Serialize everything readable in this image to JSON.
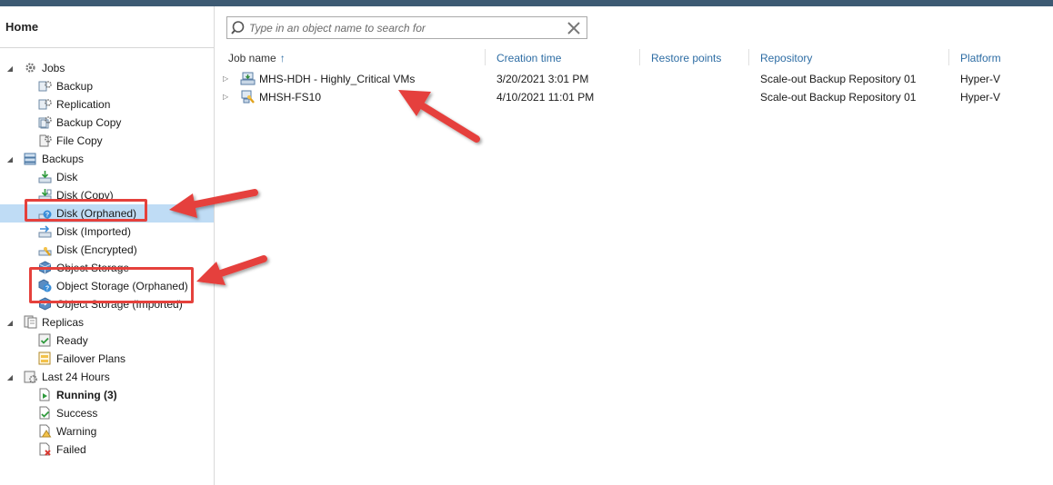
{
  "sidebar": {
    "title": "Home",
    "tree": [
      {
        "label": "Jobs",
        "icon": "jobs-gear-icon",
        "bold": false
      },
      {
        "label": "Backup",
        "icon": "backup-job-icon",
        "bold": false
      },
      {
        "label": "Replication",
        "icon": "replication-job-icon",
        "bold": false
      },
      {
        "label": "Backup Copy",
        "icon": "backup-copy-job-icon",
        "bold": false
      },
      {
        "label": "File Copy",
        "icon": "file-copy-job-icon",
        "bold": false
      },
      {
        "label": "Backups",
        "icon": "backups-icon",
        "bold": false
      },
      {
        "label": "Disk",
        "icon": "disk-icon",
        "bold": false
      },
      {
        "label": "Disk (Copy)",
        "icon": "disk-copy-icon",
        "bold": false
      },
      {
        "label": "Disk (Orphaned)",
        "icon": "disk-orphaned-icon",
        "bold": false
      },
      {
        "label": "Disk (Imported)",
        "icon": "disk-imported-icon",
        "bold": false
      },
      {
        "label": "Disk (Encrypted)",
        "icon": "disk-encrypted-icon",
        "bold": false
      },
      {
        "label": "Object Storage",
        "icon": "object-storage-icon",
        "bold": false
      },
      {
        "label": "Object Storage (Orphaned)",
        "icon": "object-storage-orphaned-icon",
        "bold": false
      },
      {
        "label": "Object Storage (Imported)",
        "icon": "object-storage-imported-icon",
        "bold": false
      },
      {
        "label": "Replicas",
        "icon": "replicas-icon",
        "bold": false
      },
      {
        "label": "Ready",
        "icon": "ready-icon",
        "bold": false
      },
      {
        "label": "Failover Plans",
        "icon": "failover-plans-icon",
        "bold": false
      },
      {
        "label": "Last 24 Hours",
        "icon": "last-24-hours-icon",
        "bold": false
      },
      {
        "label": "Running (3)",
        "icon": "running-icon",
        "bold": true
      },
      {
        "label": "Success",
        "icon": "success-icon",
        "bold": false
      },
      {
        "label": "Warning",
        "icon": "warning-icon",
        "bold": false
      },
      {
        "label": "Failed",
        "icon": "failed-icon",
        "bold": false
      }
    ]
  },
  "search": {
    "placeholder": "Type in an object name to search for",
    "value": ""
  },
  "grid": {
    "columns": [
      "Job name",
      "Creation time",
      "Restore points",
      "Repository",
      "Platform"
    ],
    "sorted_column": "Job name",
    "rows": [
      {
        "job_name": "MHS-HDH - Highly_Critical VMs",
        "creation_time": "3/20/2021 3:01 PM",
        "restore_points": "",
        "repository": "Scale-out Backup Repository 01",
        "platform": "Hyper-V",
        "icon": "vm-backup-icon"
      },
      {
        "job_name": "MHSH-FS10",
        "creation_time": "4/10/2021 11:01 PM",
        "restore_points": "",
        "repository": "Scale-out Backup Repository 01",
        "platform": "Hyper-V",
        "icon": "agent-backup-icon"
      }
    ]
  },
  "colors": {
    "topbar": "#3d5a73",
    "selection": "#bfdcf5",
    "header_link": "#2e6da4",
    "annotation_red": "#e5413c"
  }
}
